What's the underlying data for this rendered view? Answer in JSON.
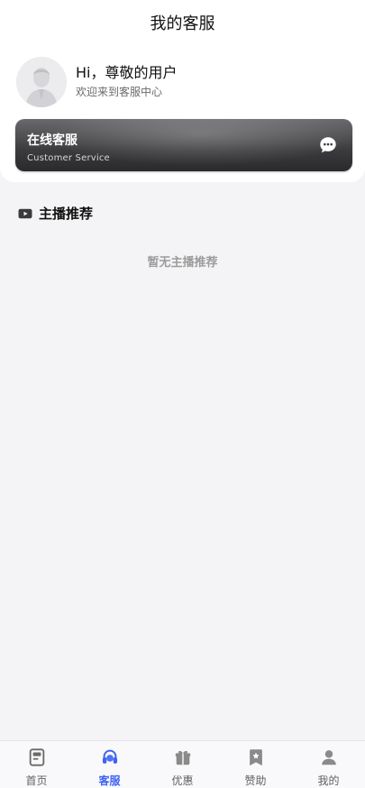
{
  "header": {
    "title": "我的客服"
  },
  "profile": {
    "greeting": "Hi，尊敬的用户",
    "subtitle": "欢迎来到客服中心"
  },
  "service_card": {
    "title": "在线客服",
    "subtitle": "Customer Service",
    "icon": "chat-bubble-icon"
  },
  "section": {
    "title": "主播推荐",
    "icon": "video-play-icon",
    "empty_text": "暂无主播推荐"
  },
  "tabs": [
    {
      "label": "首页",
      "icon": "home-icon",
      "active": false
    },
    {
      "label": "客服",
      "icon": "headset-icon",
      "active": true
    },
    {
      "label": "优惠",
      "icon": "gift-icon",
      "active": false
    },
    {
      "label": "赞助",
      "icon": "bookmark-star-icon",
      "active": false
    },
    {
      "label": "我的",
      "icon": "user-icon",
      "active": false
    }
  ],
  "colors": {
    "accent": "#3f63f3",
    "background": "#f4f4f6",
    "card_dark": "#3b3b3e"
  }
}
